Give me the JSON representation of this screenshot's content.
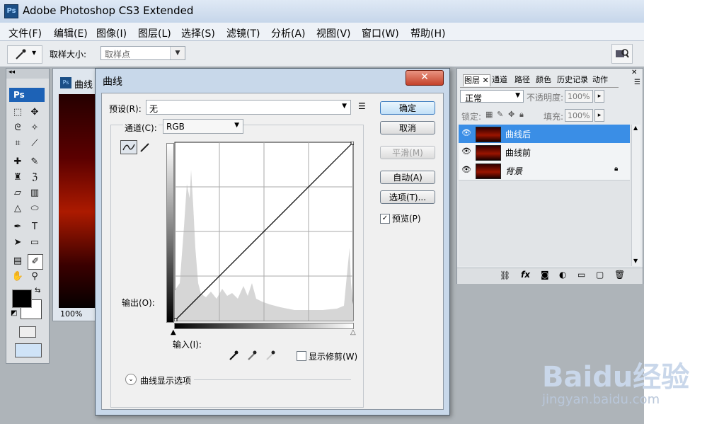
{
  "app": {
    "title": "Adobe Photoshop CS3 Extended",
    "logo": "Ps"
  },
  "menu": [
    "文件(F)",
    "编辑(E)",
    "图像(I)",
    "图层(L)",
    "选择(S)",
    "滤镜(T)",
    "分析(A)",
    "视图(V)",
    "窗口(W)",
    "帮助(H)"
  ],
  "options_bar": {
    "sample_size_label": "取样大小:",
    "sample_size_value": "取样点"
  },
  "toolbox": {
    "logo": "Ps"
  },
  "document": {
    "tab_title": "曲线",
    "zoom": "100%"
  },
  "dialog": {
    "title": "曲线",
    "close": "✕",
    "preset_label": "预设(R):",
    "preset_value": "无",
    "channel_label": "通道(C):",
    "channel_value": "RGB",
    "output_label": "输出(O):",
    "input_label": "输入(I):",
    "show_clipping_label": "显示修剪(W)",
    "curve_display_options": "曲线显示选项",
    "buttons": {
      "ok": "确定",
      "cancel": "取消",
      "smooth": "平滑(M)",
      "auto": "自动(A)",
      "options": "选项(T)...",
      "preview": "预览(P)"
    },
    "preview_checked": true
  },
  "layers_panel": {
    "tabs": [
      "图层",
      "通道",
      "路径",
      "颜色",
      "历史记录",
      "动作"
    ],
    "blend_mode": "正常",
    "opacity_label": "不透明度:",
    "opacity_value": "100%",
    "lock_label": "锁定:",
    "fill_label": "填充:",
    "fill_value": "100%",
    "layers": [
      {
        "name": "曲线后",
        "selected": true
      },
      {
        "name": "曲线前",
        "selected": false
      },
      {
        "name": "背景",
        "selected": false,
        "locked": true
      }
    ]
  },
  "watermark": {
    "brand": "Baidu经验",
    "url": "jingyan.baidu.com"
  }
}
